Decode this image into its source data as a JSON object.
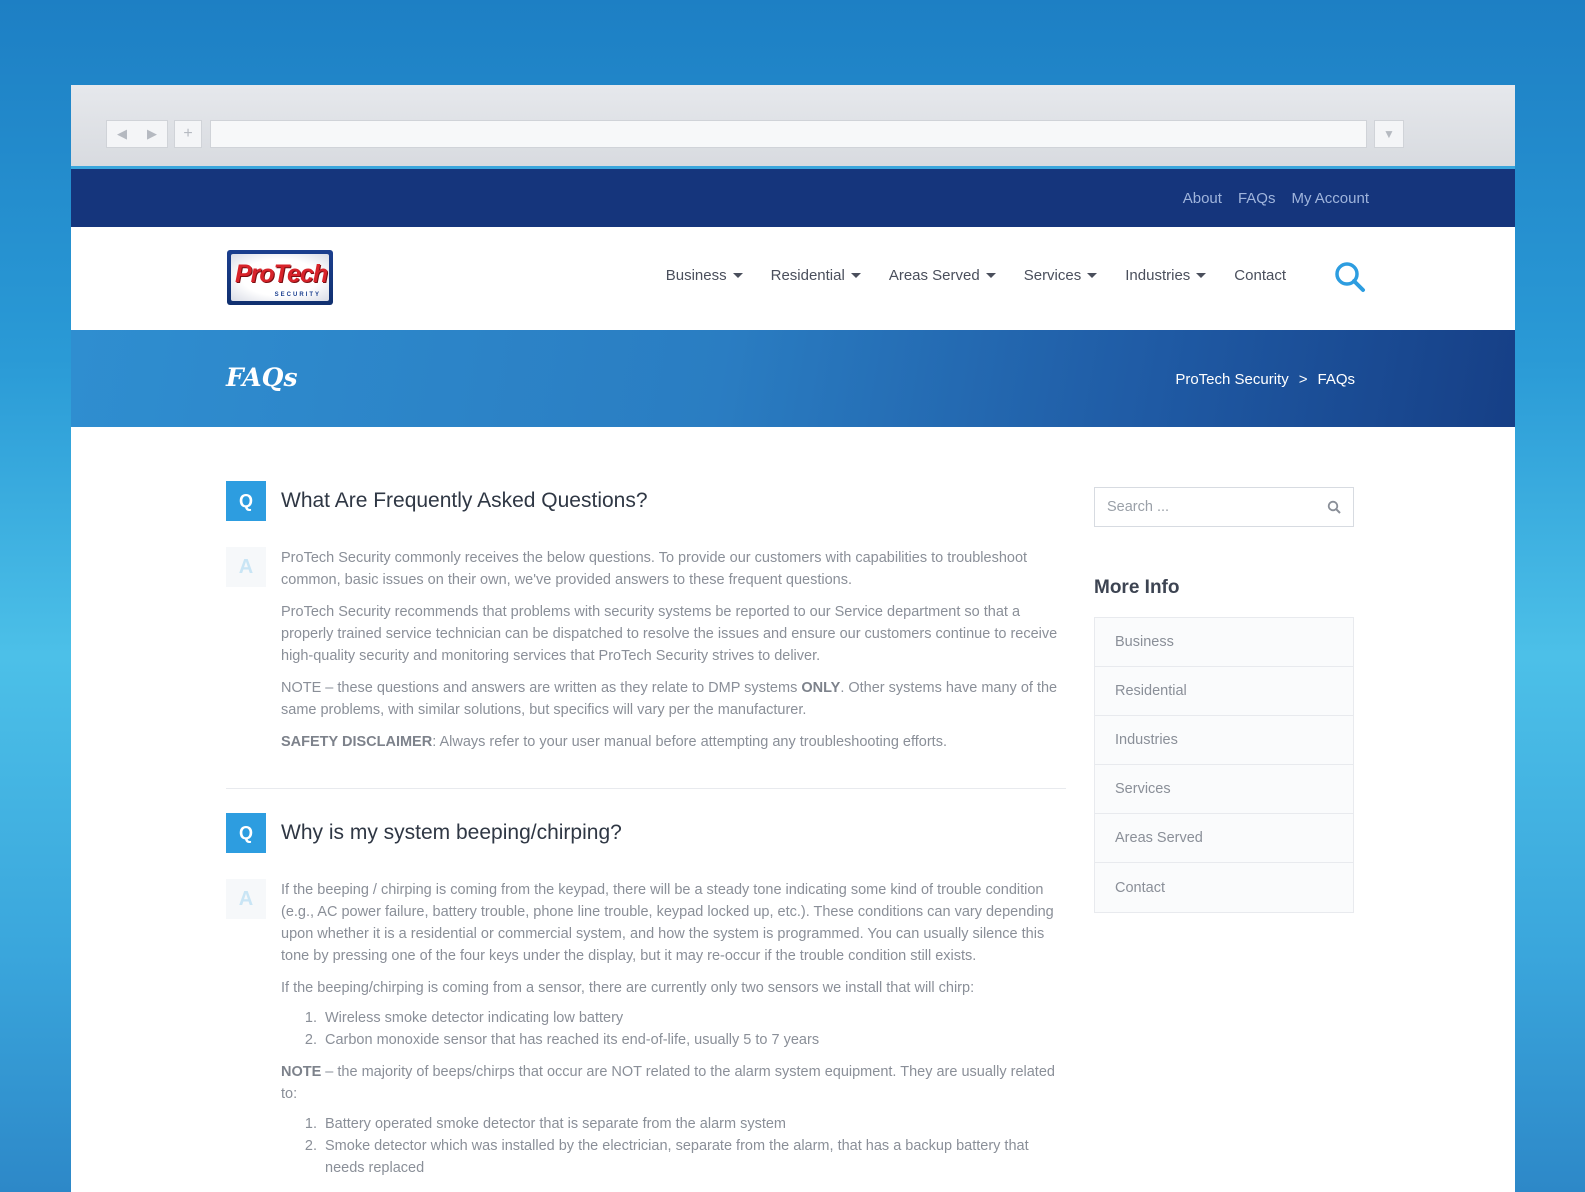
{
  "topbar": {
    "links": [
      "About",
      "FAQs",
      "My Account"
    ]
  },
  "logo": {
    "text": "ProTech",
    "sub": "SECURITY"
  },
  "nav": {
    "items": [
      {
        "label": "Business"
      },
      {
        "label": "Residential"
      },
      {
        "label": "Areas Served"
      },
      {
        "label": "Services"
      },
      {
        "label": "Industries"
      },
      {
        "label": "Contact"
      }
    ]
  },
  "banner": {
    "title": "FAQs",
    "crumbs": [
      "ProTech Security",
      ">",
      "FAQs"
    ]
  },
  "faq1": {
    "q_badge": "Q",
    "a_badge": "A",
    "question": "What Are Frequently Asked Questions?",
    "p1": "ProTech Security commonly receives the below questions. To provide our customers with capabilities to troubleshoot common, basic issues on their own, we've provided answers to these frequent questions.",
    "p2": "ProTech Security recommends that problems with security systems be reported to our Service department so that a properly trained service technician can be dispatched to resolve the issues and ensure our customers continue to receive high-quality security and monitoring services that ProTech Security strives to deliver.",
    "p3a": "NOTE – these questions and answers are written as they relate to DMP systems ",
    "p3b": "ONLY",
    "p3c": ". Other systems have many of the same problems, with similar solutions, but specifics will vary per the manufacturer.",
    "p4a": "SAFETY DISCLAIMER",
    "p4b": ": Always refer to your user manual before attempting any troubleshooting efforts."
  },
  "faq2": {
    "q_badge": "Q",
    "a_badge": "A",
    "question": "Why is my system beeping/chirping?",
    "p1": "If the beeping / chirping is coming from the keypad, there will be a steady tone indicating some kind of trouble condition (e.g., AC power failure, battery trouble, phone line trouble, keypad locked up, etc.). These conditions can vary depending upon whether it is a residential or commercial system, and how the system is programmed. You can usually silence this tone by pressing one of the four keys under the display, but it may re-occur if the trouble condition still exists.",
    "p2": "If the beeping/chirping is coming from a sensor, there are currently only two sensors we install that will chirp:",
    "list1": [
      "Wireless smoke detector indicating low battery",
      "Carbon monoxide sensor that has reached its end-of-life, usually 5 to 7 years"
    ],
    "p3a": "NOTE",
    "p3b": " – the majority of beeps/chirps that occur are NOT related to the alarm system equipment. They are usually related to:",
    "list2": [
      "Battery operated smoke detector that is separate from the alarm system",
      "Smoke detector which was installed by the electrician, separate from the alarm, that has a backup battery that needs replaced"
    ]
  },
  "sidebar": {
    "search_placeholder": "Search ...",
    "heading": "More Info",
    "links": [
      "Business",
      "Residential",
      "Industries",
      "Services",
      "Areas Served",
      "Contact"
    ]
  },
  "colors": {
    "accent": "#2d9de0",
    "topbar": "#15357c"
  },
  "icons": [
    "back-icon",
    "forward-icon",
    "plus-icon",
    "download-icon",
    "search-icon",
    "caret-down-icon"
  ]
}
